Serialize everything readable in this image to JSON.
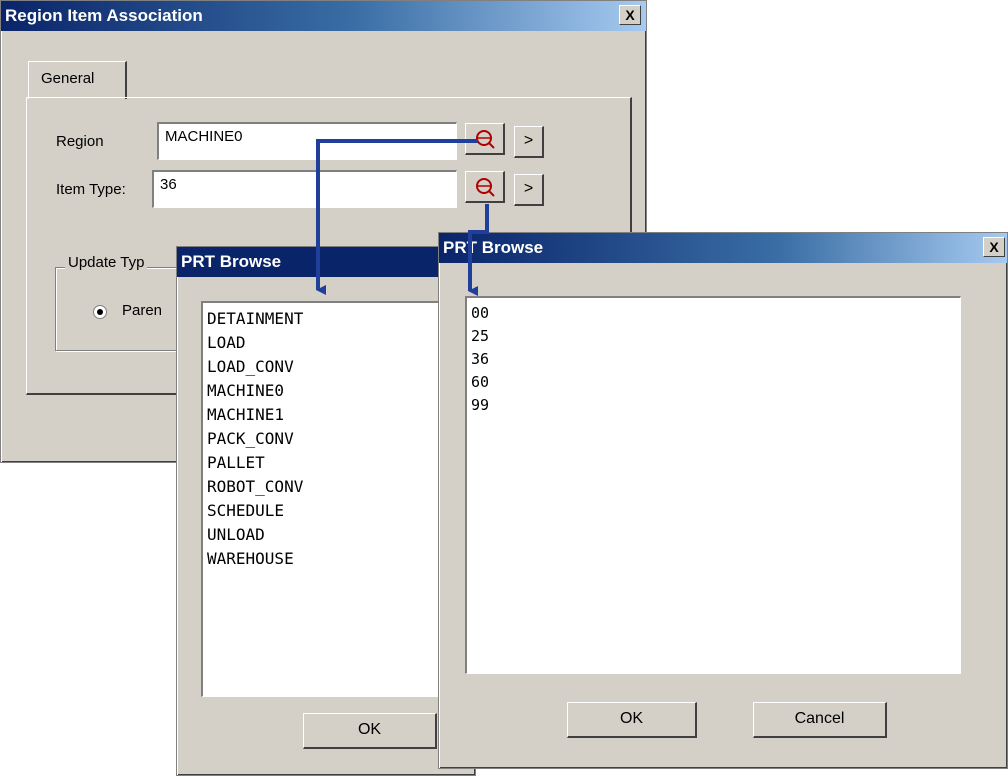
{
  "main_dialog": {
    "title": "Region Item Association",
    "tab_general": "General",
    "region_label": "Region",
    "region_value": "MACHINE0",
    "item_type_label": "Item Type:",
    "item_type_value": "36",
    "arrow_button_label": ">",
    "update_type_label": "Update Typ",
    "radio_parent_label": "Paren",
    "close_label": "X"
  },
  "browse_left": {
    "title": "PRT Browse",
    "items": [
      "DETAINMENT",
      "LOAD",
      "LOAD_CONV",
      "MACHINE0",
      "MACHINE1",
      "PACK_CONV",
      "PALLET",
      "ROBOT_CONV",
      "SCHEDULE",
      "UNLOAD",
      "WAREHOUSE"
    ],
    "ok_label": "OK"
  },
  "browse_right": {
    "title": "PRT Browse",
    "items": [
      "00",
      "25",
      "36",
      "60",
      "99"
    ],
    "ok_label": "OK",
    "cancel_label": "Cancel",
    "close_label": "X"
  },
  "icons": {
    "browse_button_icon": "search-icon",
    "callout_color": "#1f3f9a"
  }
}
